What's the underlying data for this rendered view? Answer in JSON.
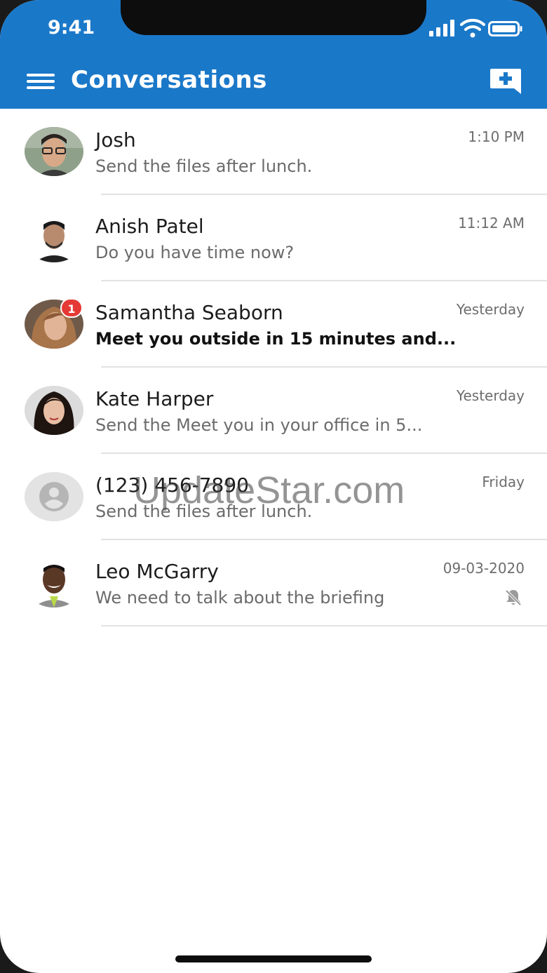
{
  "status_bar": {
    "time": "9:41"
  },
  "header": {
    "title": "Conversations",
    "background_color": "#1a78c9"
  },
  "conversations": [
    {
      "name": "Josh",
      "time": "1:10 PM",
      "preview": "Send the files after lunch.",
      "unread": false,
      "avatar": "photo"
    },
    {
      "name": "Anish Patel",
      "time": "11:12 AM",
      "preview": "Do you have time now?",
      "unread": false,
      "avatar": "photo"
    },
    {
      "name": "Samantha Seaborn",
      "time": "Yesterday",
      "preview": "Meet you outside in 15 minutes and...",
      "unread": true,
      "unread_count": "1",
      "avatar": "photo"
    },
    {
      "name": "Kate Harper",
      "time": "Yesterday",
      "preview": "Send the Meet you in your office in 5...",
      "unread": false,
      "avatar": "photo"
    },
    {
      "name": "(123) 456-7890",
      "time": "Friday",
      "preview": "Send the files after lunch.",
      "unread": false,
      "avatar": "person-placeholder-icon"
    },
    {
      "name": "Leo McGarry",
      "time": "09-03-2020",
      "preview": "We need to talk about the briefing",
      "unread": false,
      "muted": true,
      "avatar": "photo"
    }
  ],
  "watermark": "UpdateStar.com",
  "colors": {
    "badge": "#e53935",
    "accent": "#1a78c9"
  }
}
